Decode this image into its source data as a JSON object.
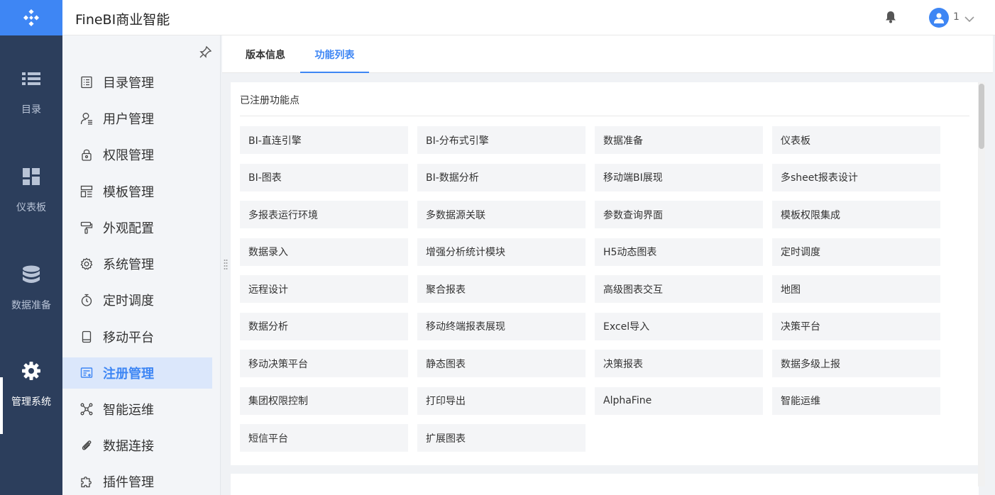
{
  "header": {
    "title": "FineBI商业智能",
    "user": "1"
  },
  "rail": {
    "items": [
      {
        "label": "目录",
        "icon": "list-icon"
      },
      {
        "label": "仪表板",
        "icon": "dashboard-icon"
      },
      {
        "label": "数据准备",
        "icon": "database-icon"
      },
      {
        "label": "管理系统",
        "icon": "gear-icon",
        "active": true
      }
    ]
  },
  "sidebar": {
    "items": [
      {
        "label": "目录管理",
        "icon": "catalog-icon"
      },
      {
        "label": "用户管理",
        "icon": "user-icon"
      },
      {
        "label": "权限管理",
        "icon": "lock-icon"
      },
      {
        "label": "模板管理",
        "icon": "template-icon"
      },
      {
        "label": "外观配置",
        "icon": "paint-roller-icon"
      },
      {
        "label": "系统管理",
        "icon": "gear-icon"
      },
      {
        "label": "定时调度",
        "icon": "timer-icon"
      },
      {
        "label": "移动平台",
        "icon": "mobile-icon"
      },
      {
        "label": "注册管理",
        "icon": "register-icon",
        "active": true
      },
      {
        "label": "智能运维",
        "icon": "network-icon"
      },
      {
        "label": "数据连接",
        "icon": "paperclip-icon"
      },
      {
        "label": "插件管理",
        "icon": "puzzle-icon"
      }
    ]
  },
  "tabs": [
    {
      "label": "版本信息"
    },
    {
      "label": "功能列表",
      "active": true
    }
  ],
  "features": {
    "title": "已注册功能点",
    "items": [
      "BI-直连引擎",
      "BI-分布式引擎",
      "数据准备",
      "仪表板",
      "BI-图表",
      "BI-数据分析",
      "移动端BI展现",
      "多sheet报表设计",
      "多报表运行环境",
      "多数据源关联",
      "参数查询界面",
      "模板权限集成",
      "数据录入",
      "增强分析统计模块",
      "H5动态图表",
      "定时调度",
      "远程设计",
      "聚合报表",
      "高级图表交互",
      "地图",
      "数据分析",
      "移动终端报表展现",
      "Excel导入",
      "决策平台",
      "移动决策平台",
      "静态图表",
      "决策报表",
      "数据多级上报",
      "集团权限控制",
      "打印导出",
      "AlphaFine",
      "智能运维",
      "短信平台",
      "扩展图表"
    ]
  },
  "colors": {
    "accent": "#3e86f4",
    "rail_bg": "#2c3e5c",
    "sidebar_bg": "#f3f5f8",
    "active_item_bg": "#dbe7fb",
    "feature_bg": "#f4f5f7"
  }
}
